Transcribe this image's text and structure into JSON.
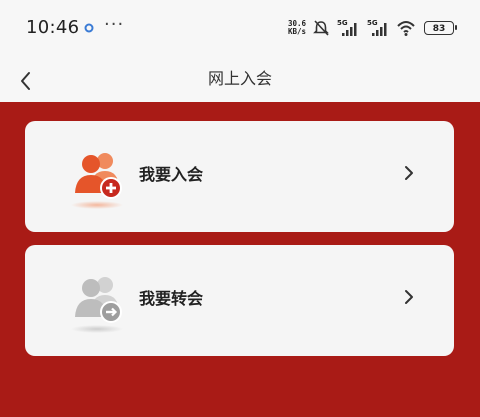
{
  "status_bar": {
    "time": "10:46",
    "dots": "···",
    "net_speed_value": "30.6",
    "net_speed_unit": "KB/s",
    "battery": "83",
    "signal_label_1": "5G",
    "signal_label_2": "5G"
  },
  "header": {
    "title": "网上入会"
  },
  "cards": [
    {
      "label": "我要入会",
      "icon": "people-add-icon",
      "color": "#e5552a"
    },
    {
      "label": "我要转会",
      "icon": "people-transfer-icon",
      "color": "#b9b9b9"
    }
  ],
  "colors": {
    "background_red": "#a91b16",
    "card_bg": "#f5f5f5"
  }
}
